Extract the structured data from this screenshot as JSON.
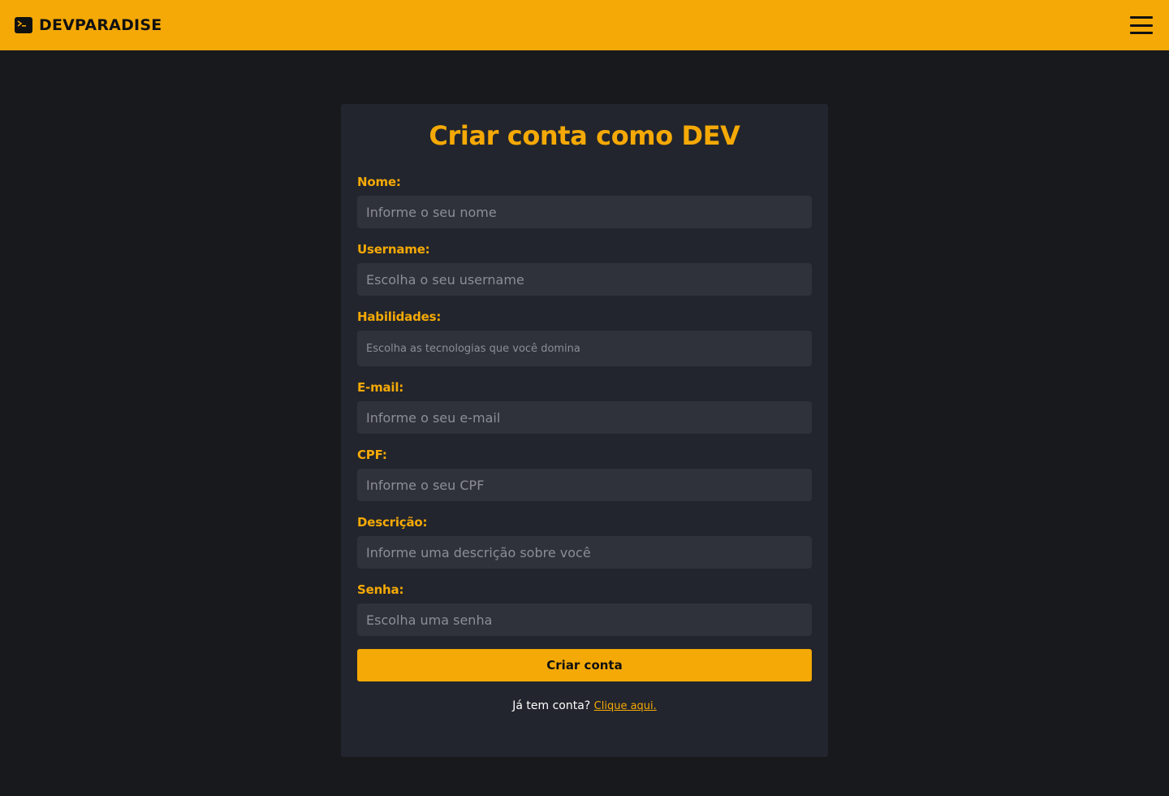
{
  "header": {
    "brand_name": "DEVPARADISE",
    "brand_icon": "terminal-icon",
    "menu_icon": "hamburger-menu-icon"
  },
  "colors": {
    "accent": "#f5a906",
    "background": "#18191d",
    "card": "#22252d",
    "input": "#2f323b",
    "placeholder": "#8c8e94"
  },
  "form": {
    "title": "Criar conta como DEV",
    "fields": [
      {
        "label": "Nome:",
        "placeholder": "Informe o seu nome",
        "value": ""
      },
      {
        "label": "Username:",
        "placeholder": "Escolha o seu username",
        "value": ""
      },
      {
        "label": "Habilidades:",
        "placeholder": "Escolha as tecnologias que você domina",
        "value": ""
      },
      {
        "label": "E-mail:",
        "placeholder": "Informe o seu e-mail",
        "value": ""
      },
      {
        "label": "CPF:",
        "placeholder": "Informe o seu CPF",
        "value": ""
      },
      {
        "label": "Descrição:",
        "placeholder": "Informe uma descrição sobre você",
        "value": ""
      },
      {
        "label": "Senha:",
        "placeholder": "Escolha uma senha",
        "value": ""
      }
    ],
    "submit_label": "Criar conta",
    "login_question": "Já tem conta?",
    "login_link": "Clique aqui."
  }
}
